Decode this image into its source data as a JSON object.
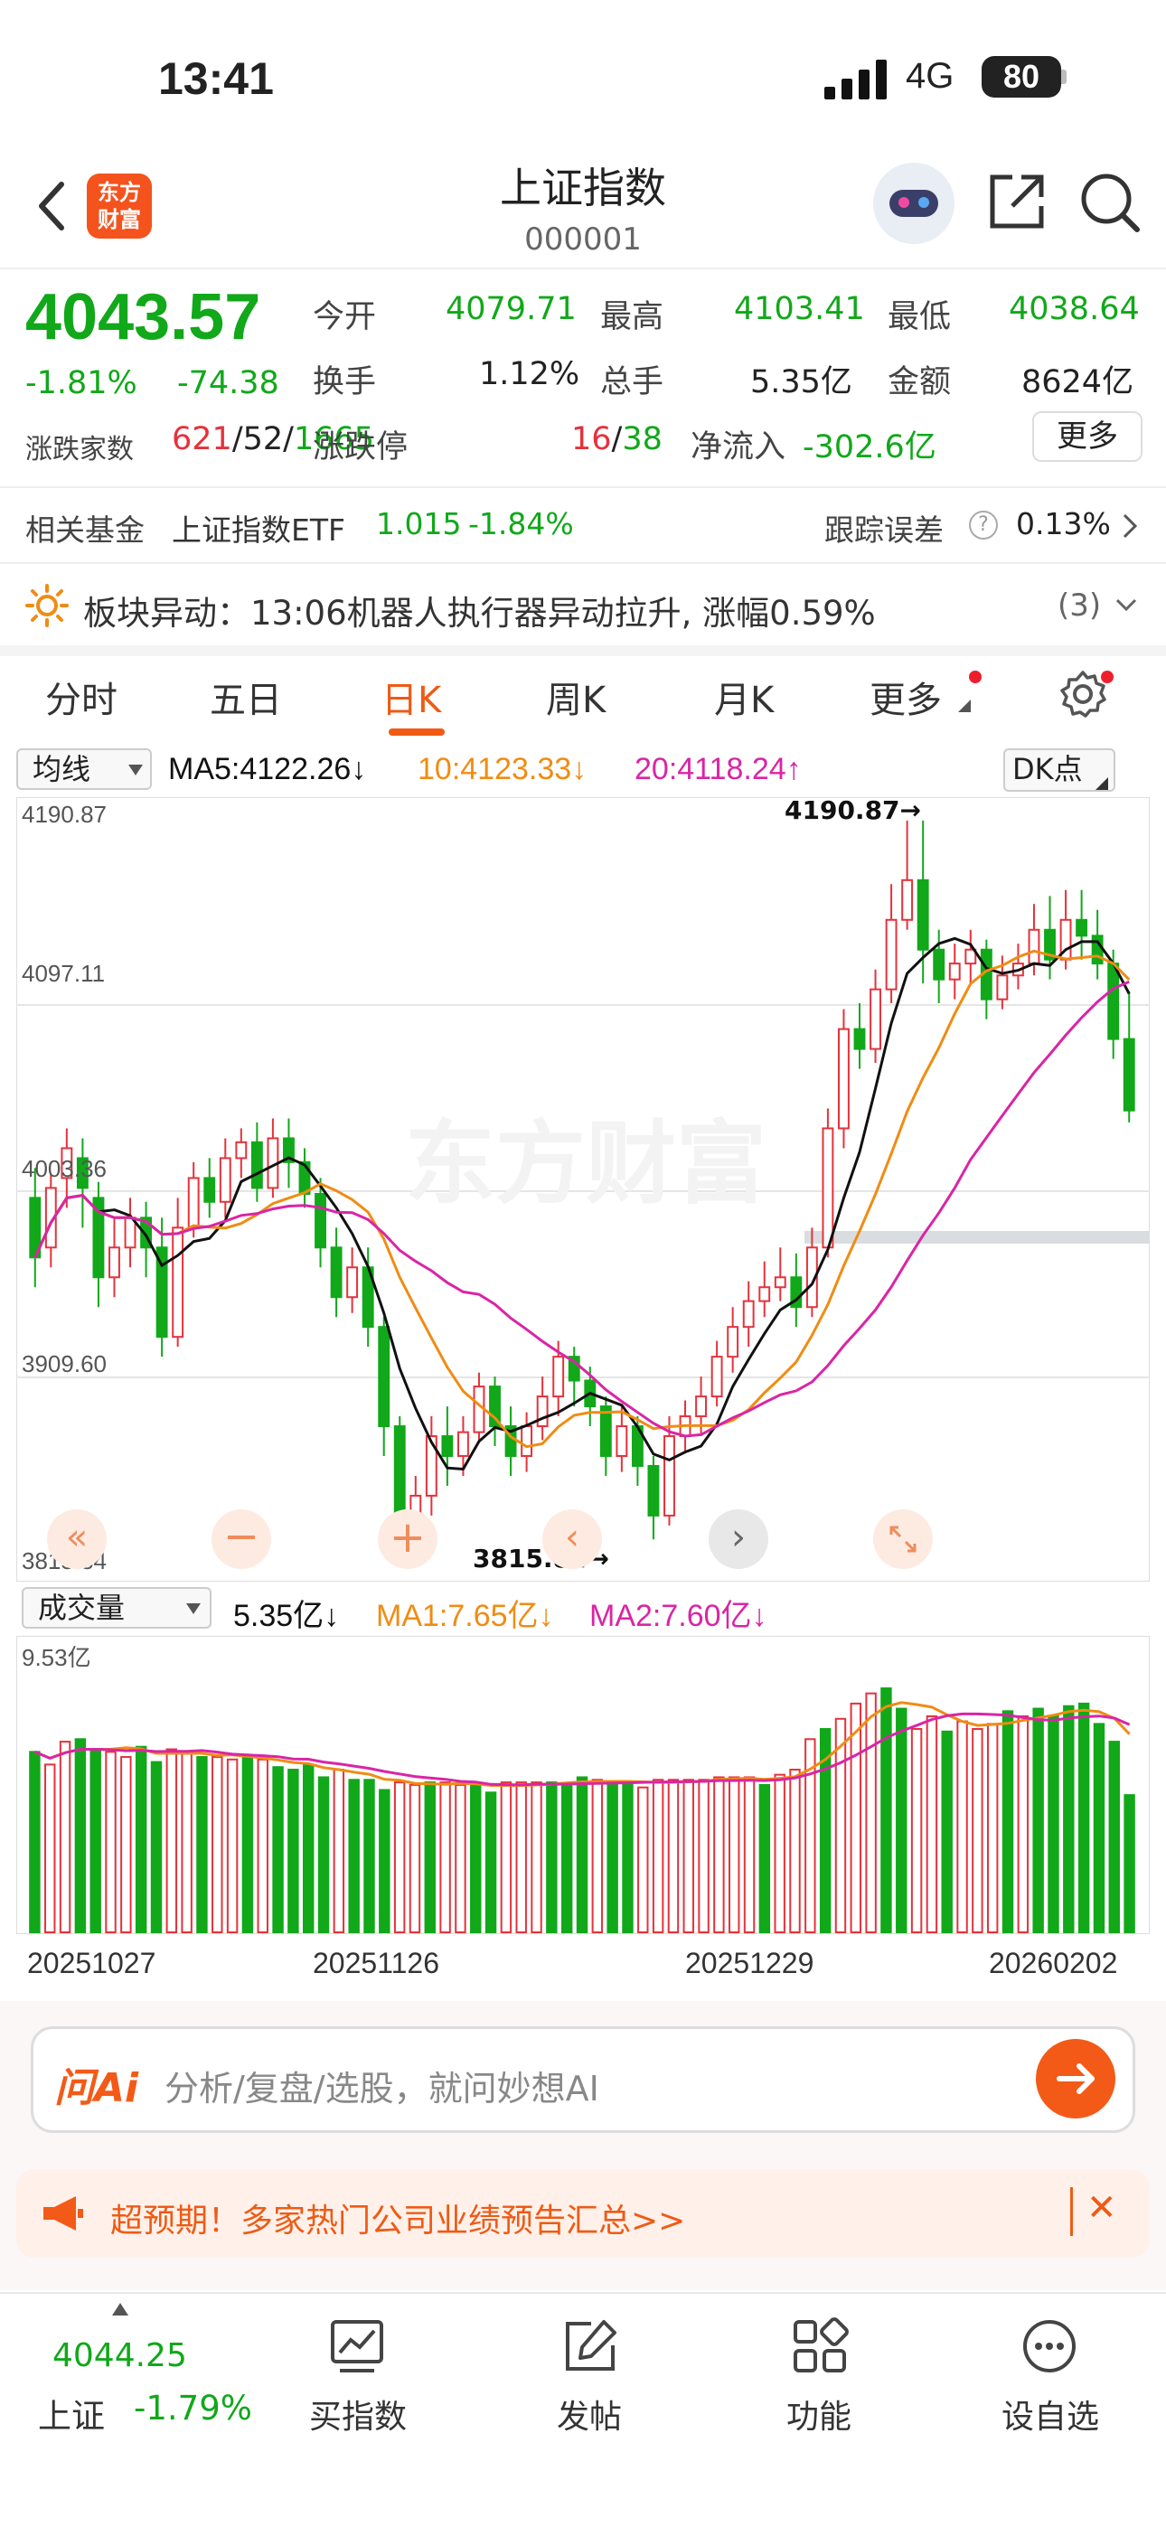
{
  "status": {
    "time": "13:41",
    "network": "4G",
    "battery": "80"
  },
  "header": {
    "title": "上证指数",
    "code": "000001",
    "logo_text_1": "东方",
    "logo_text_2": "财富"
  },
  "quote": {
    "price": "4043.57",
    "pct": "-1.81%",
    "chg": "-74.38",
    "open_label": "今开",
    "open": "4079.71",
    "high_label": "最高",
    "high": "4103.41",
    "low_label": "最低",
    "low": "4038.64",
    "turnover_label": "换手",
    "turnover": "1.12%",
    "volume_label": "总手",
    "volume": "5.35亿",
    "amount_label": "金额",
    "amount": "8624亿",
    "breadth_label": "涨跌家数",
    "breadth_up": "621",
    "breadth_flat": "52",
    "breadth_down": "1665",
    "limit_label": "涨跌停",
    "limit_up": "16",
    "limit_down": "38",
    "netflow_label": "净流入",
    "netflow": "-302.6亿",
    "more": "更多"
  },
  "fund": {
    "label": "相关基金",
    "name": "上证指数ETF",
    "price": "1.015",
    "pct": "-1.84%",
    "err_label": "跟踪误差",
    "err": "0.13%"
  },
  "alert": {
    "text": "板块异动：13:06机器人执行器异动拉升, 涨幅0.59%",
    "count": "(3)"
  },
  "tabs": [
    "分时",
    "五日",
    "日K",
    "周K",
    "月K",
    "更多"
  ],
  "ma": {
    "selector": "均线",
    "ma5": "MA5:4122.26↓",
    "ma10": "10:4123.33↓",
    "ma20": "20:4118.24↑",
    "dk": "DK点"
  },
  "price_axis": [
    "4190.87",
    "4097.11",
    "4003.36",
    "3909.60",
    "3815.84"
  ],
  "annotations": {
    "high": "4190.87→",
    "low": "3815.84→"
  },
  "watermark": "东方财富",
  "vol": {
    "selector": "成交量",
    "value": "5.35亿↓",
    "ma1": "MA1:7.65亿↓",
    "ma2": "MA2:7.60亿↓",
    "max": "9.53亿"
  },
  "dates": [
    "20251027",
    "20251126",
    "20251229",
    "20260202"
  ],
  "ai": {
    "logo": "问Ai",
    "placeholder": "分析/复盘/选股，就问妙想AI"
  },
  "banner": {
    "text": "超预期！多家热门公司业绩预告汇总>>"
  },
  "bottom": {
    "index_price": "4044.25",
    "index_name": "上证",
    "index_pct": "-1.79%",
    "items": [
      "买指数",
      "发帖",
      "功能",
      "设自选"
    ]
  },
  "colors": {
    "up": "#e5323b",
    "down": "#11a81a",
    "accent": "#f05a14",
    "ma5": "#111111",
    "ma10": "#f08c13",
    "ma20": "#d925a6"
  },
  "chart_data": {
    "type": "candlestick",
    "y_range": [
      3815.84,
      4190.87
    ],
    "candles": [
      [
        4000,
        3970,
        4015,
        3955
      ],
      [
        3975,
        4005,
        4012,
        3965
      ],
      [
        4010,
        4025,
        4035,
        3995
      ],
      [
        4020,
        4005,
        4030,
        3985
      ],
      [
        4000,
        3960,
        4008,
        3945
      ],
      [
        3960,
        3975,
        3990,
        3950
      ],
      [
        3975,
        3990,
        4000,
        3965
      ],
      [
        3990,
        3975,
        3998,
        3960
      ],
      [
        3975,
        3930,
        3990,
        3920
      ],
      [
        3930,
        3985,
        4000,
        3925
      ],
      [
        3985,
        4010,
        4018,
        3980
      ],
      [
        4010,
        3998,
        4020,
        3990
      ],
      [
        3998,
        4020,
        4030,
        3990
      ],
      [
        4020,
        4028,
        4035,
        4010
      ],
      [
        4028,
        4005,
        4038,
        3998
      ],
      [
        4005,
        4030,
        4040,
        4000
      ],
      [
        4030,
        4018,
        4040,
        4005
      ],
      [
        4018,
        4002,
        4025,
        3995
      ],
      [
        4002,
        3975,
        4010,
        3965
      ],
      [
        3975,
        3950,
        3985,
        3940
      ],
      [
        3950,
        3965,
        3975,
        3942
      ],
      [
        3965,
        3935,
        3975,
        3925
      ],
      [
        3935,
        3885,
        3940,
        3870
      ],
      [
        3885,
        3835,
        3890,
        3820
      ],
      [
        3835,
        3850,
        3860,
        3830
      ],
      [
        3850,
        3880,
        3890,
        3840
      ],
      [
        3880,
        3870,
        3895,
        3855
      ],
      [
        3870,
        3882,
        3890,
        3860
      ],
      [
        3882,
        3905,
        3912,
        3878
      ],
      [
        3905,
        3885,
        3910,
        3875
      ],
      [
        3885,
        3870,
        3895,
        3860
      ],
      [
        3870,
        3885,
        3892,
        3862
      ],
      [
        3885,
        3900,
        3910,
        3878
      ],
      [
        3900,
        3920,
        3928,
        3890
      ],
      [
        3920,
        3908,
        3925,
        3895
      ],
      [
        3908,
        3895,
        3915,
        3885
      ],
      [
        3895,
        3870,
        3900,
        3860
      ],
      [
        3870,
        3885,
        3895,
        3862
      ],
      [
        3885,
        3865,
        3890,
        3855
      ],
      [
        3865,
        3840,
        3870,
        3828
      ],
      [
        3840,
        3880,
        3890,
        3835
      ],
      [
        3880,
        3890,
        3898,
        3872
      ],
      [
        3890,
        3900,
        3910,
        3880
      ],
      [
        3900,
        3920,
        3928,
        3895
      ],
      [
        3920,
        3935,
        3945,
        3912
      ],
      [
        3935,
        3948,
        3958,
        3925
      ],
      [
        3948,
        3955,
        3968,
        3940
      ],
      [
        3955,
        3960,
        3975,
        3948
      ],
      [
        3960,
        3945,
        3972,
        3935
      ],
      [
        3945,
        3975,
        3985,
        3940
      ],
      [
        3975,
        4035,
        4045,
        3970
      ],
      [
        4035,
        4085,
        4095,
        4025
      ],
      [
        4085,
        4075,
        4098,
        4065
      ],
      [
        4075,
        4105,
        4115,
        4068
      ],
      [
        4105,
        4140,
        4158,
        4098
      ],
      [
        4140,
        4160,
        4190,
        4135
      ],
      [
        4160,
        4125,
        4190,
        4108
      ],
      [
        4125,
        4110,
        4135,
        4098
      ],
      [
        4110,
        4118,
        4128,
        4100
      ],
      [
        4118,
        4125,
        4135,
        4108
      ],
      [
        4125,
        4100,
        4130,
        4090
      ],
      [
        4100,
        4112,
        4122,
        4095
      ],
      [
        4112,
        4118,
        4128,
        4105
      ],
      [
        4118,
        4135,
        4148,
        4112
      ],
      [
        4135,
        4120,
        4152,
        4110
      ],
      [
        4120,
        4140,
        4155,
        4115
      ],
      [
        4140,
        4132,
        4155,
        4120
      ],
      [
        4132,
        4118,
        4145,
        4110
      ],
      [
        4118,
        4080,
        4125,
        4070
      ],
      [
        4080,
        4044,
        4104,
        4038
      ]
    ],
    "volumes": [
      7.1,
      6.6,
      7.5,
      7.6,
      7.2,
      7.1,
      6.9,
      7.3,
      6.7,
      7.2,
      7.1,
      6.9,
      6.9,
      6.8,
      6.9,
      6.8,
      6.5,
      6.4,
      6.6,
      6.1,
      6.4,
      6.0,
      6.0,
      5.6,
      5.9,
      5.8,
      5.9,
      5.9,
      5.8,
      5.8,
      5.5,
      5.9,
      5.9,
      5.9,
      5.9,
      5.8,
      6.1,
      6.0,
      5.9,
      5.9,
      5.7,
      6.0,
      6.0,
      6.0,
      6.0,
      6.1,
      6.1,
      6.1,
      5.8,
      6.2,
      6.4,
      7.6,
      8.0,
      8.4,
      9.0,
      9.4,
      9.6,
      8.8,
      8.0,
      8.5,
      7.9,
      8.3,
      8.0,
      8.2,
      8.7,
      8.5,
      8.8,
      8.5,
      8.9,
      9.0,
      8.2,
      7.5,
      5.4
    ]
  }
}
